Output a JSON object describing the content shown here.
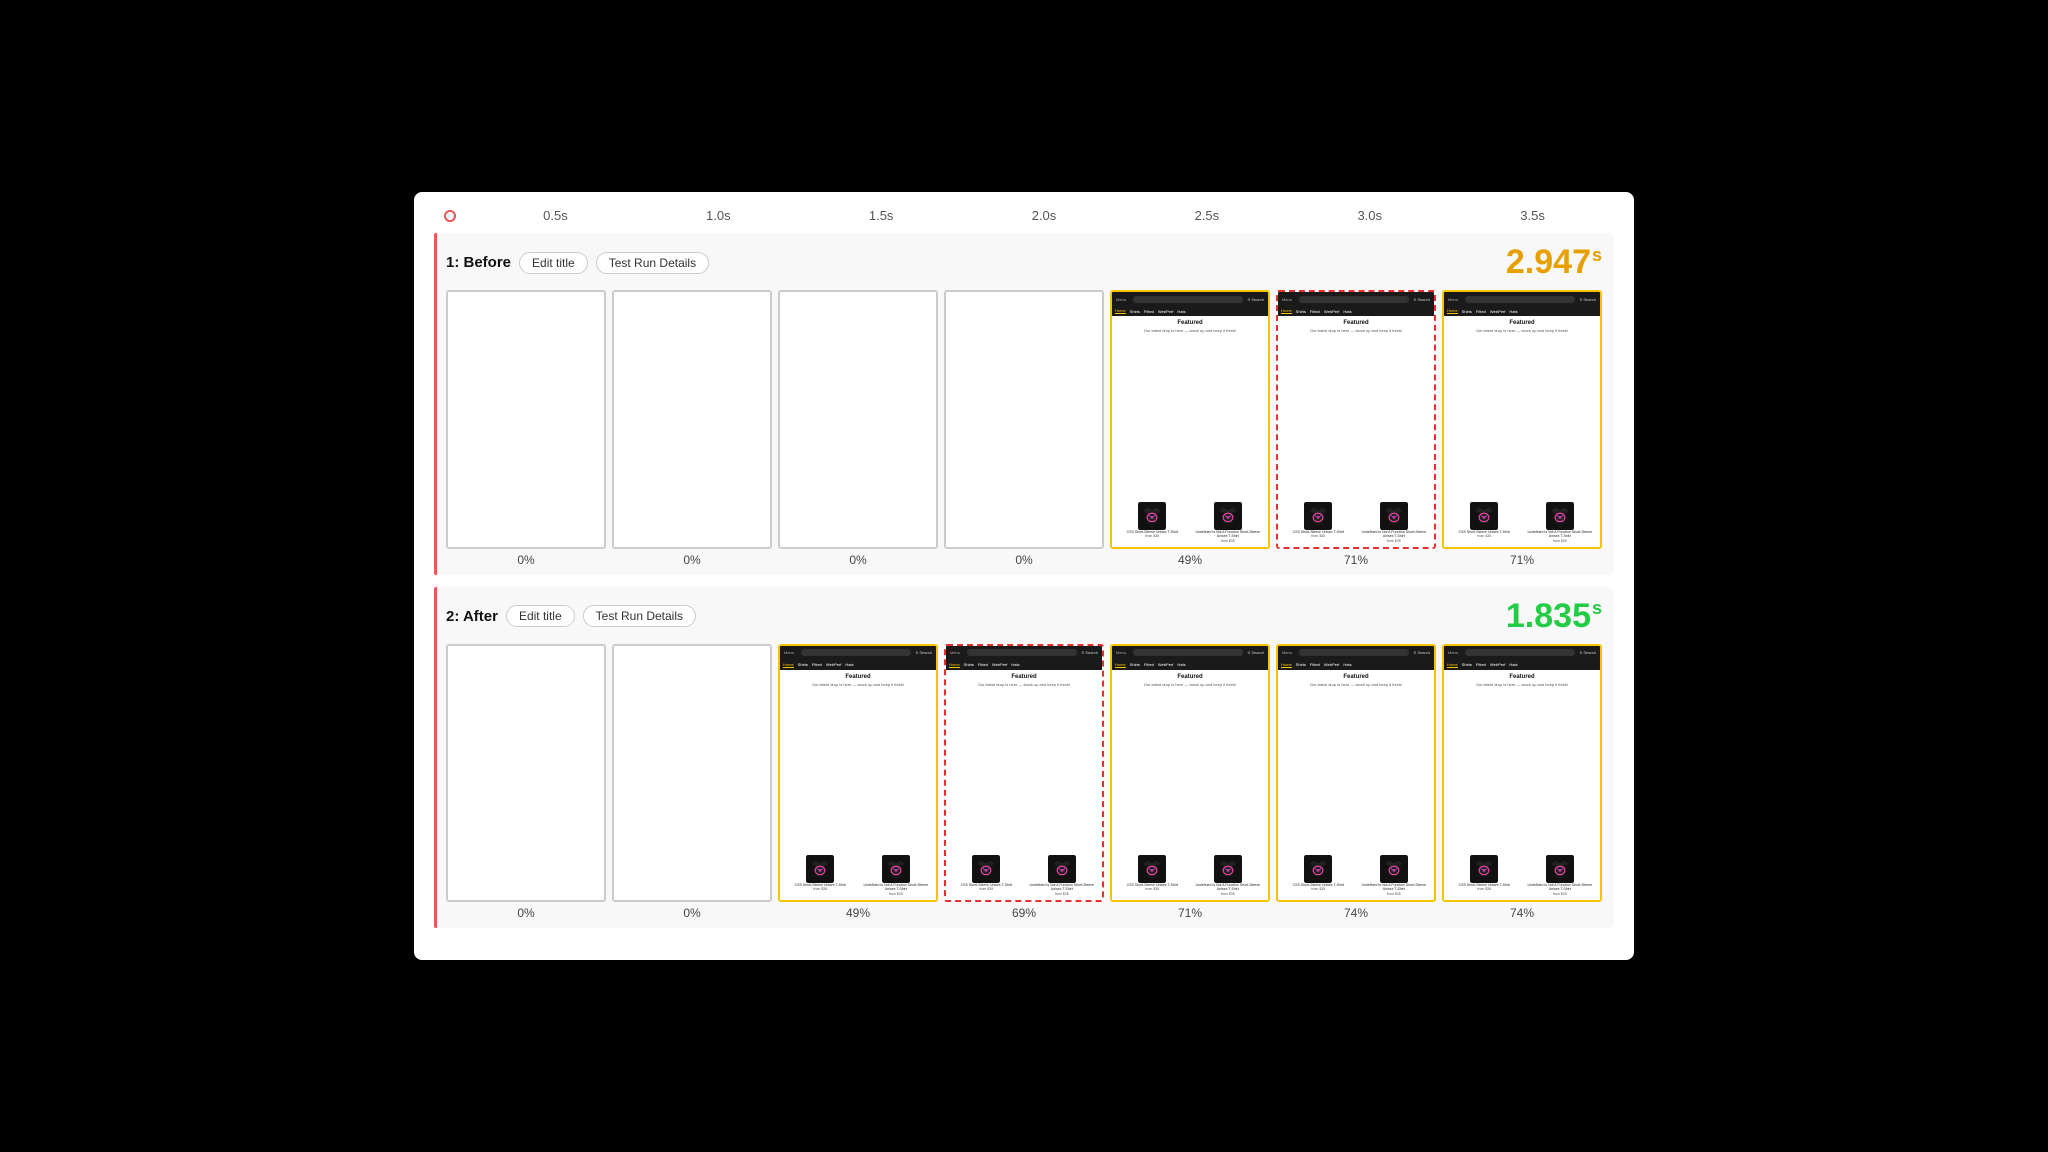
{
  "timeline": {
    "ticks": [
      "0.5s",
      "1.0s",
      "1.5s",
      "2.0s",
      "2.5s",
      "3.0s",
      "3.5s"
    ]
  },
  "before": {
    "label": "1: Before",
    "edit_title": "Edit title",
    "test_run": "Test Run Details",
    "score": "2.947",
    "score_unit": "s",
    "frames": [
      {
        "pct": "0%",
        "type": "empty"
      },
      {
        "pct": "0%",
        "type": "empty"
      },
      {
        "pct": "0%",
        "type": "empty"
      },
      {
        "pct": "0%",
        "type": "empty"
      },
      {
        "pct": "49%",
        "type": "browser",
        "highlight": "yellow"
      },
      {
        "pct": "71%",
        "type": "browser",
        "highlight": "red"
      },
      {
        "pct": "71%",
        "type": "browser",
        "highlight": "yellow"
      }
    ]
  },
  "after": {
    "label": "2: After",
    "edit_title": "Edit title",
    "test_run": "Test Run Details",
    "score": "1.835",
    "score_unit": "s",
    "frames": [
      {
        "pct": "0%",
        "type": "empty"
      },
      {
        "pct": "0%",
        "type": "empty"
      },
      {
        "pct": "49%",
        "type": "browser",
        "highlight": "yellow"
      },
      {
        "pct": "69%",
        "type": "browser",
        "highlight": "red"
      },
      {
        "pct": "71%",
        "type": "browser",
        "highlight": "yellow"
      },
      {
        "pct": "74%",
        "type": "browser",
        "highlight": "yellow"
      },
      {
        "pct": "74%",
        "type": "browser",
        "highlight": "yellow"
      }
    ]
  },
  "nav_items": [
    "Home",
    "Shirts",
    "Fitted",
    "WebPerf",
    "Hats"
  ],
  "featured_heading": "Featured",
  "featured_sub": "Our latest drop is here — stock up and keep it fresh!",
  "product1_name": "CSS Short-Sleeve Unisex T-Shirt",
  "product1_price": "from $35",
  "product2_name": "Undefined Is Not A Function Short-Sleeve Unisex T-Shirt",
  "product2_price": "from $35"
}
